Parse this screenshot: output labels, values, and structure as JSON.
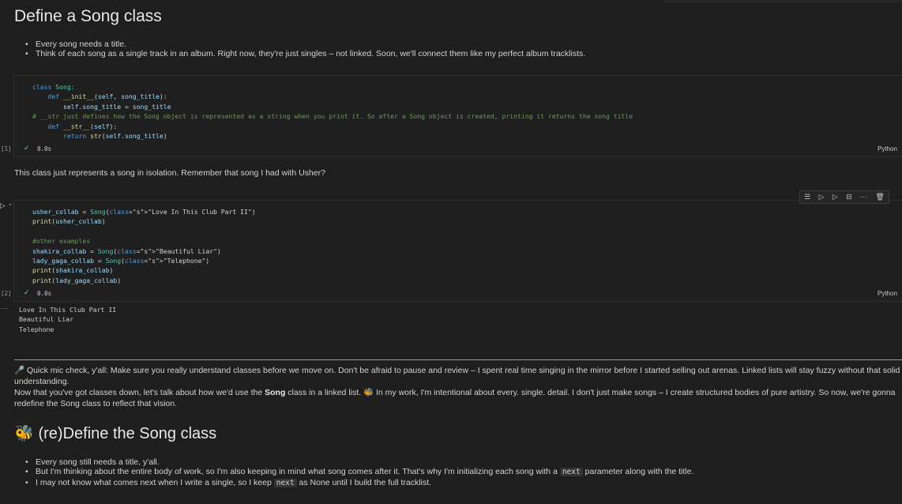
{
  "section1": {
    "title": "Define a Song class",
    "bullets": [
      "Every song needs a title.",
      "Think of each song as a single track in an album. Right now, they're just singles – not linked. Soon, we'll connect them like my perfect album tracklists."
    ]
  },
  "cell1": {
    "exec_count": "[1]",
    "status_time": "0.0s",
    "language": "Python",
    "code_lines": [
      "class Song:",
      "    def __init__(self, song_title):",
      "        self.song_title = song_title",
      "# __str just defines how the Song object is represented as a string when you print it. So after a Song object is created, printing it returns the song title",
      "    def __str__(self):",
      "        return str(self.song_title)"
    ]
  },
  "para1": "This class just represents a song in isolation. Remember that song I had with Usher?",
  "cell2": {
    "exec_count": "[2]",
    "status_time": "0.0s",
    "language": "Python",
    "code_lines": [
      "usher_collab = Song(\"Love In This Club Part II\")",
      "print(usher_collab)",
      "",
      "#other examples",
      "shakira_collab = Song(\"Beautiful Liar\")",
      "lady_gaga_collab = Song(\"Telephone\")",
      "print(shakira_collab)",
      "print(lady_gaga_collab)"
    ],
    "output_lines": [
      "Love In This Club Part II",
      "Beautiful Liar",
      "Telephone"
    ],
    "toolbar_icons": [
      "run-by-line-icon",
      "execute-above-icon",
      "execute-below-icon",
      "split-cell-icon",
      "more-icon",
      "delete-icon"
    ]
  },
  "para2": {
    "line1_icon": "🎤",
    "line1": "Quick mic check, y'all: Make sure you really understand classes before we move on. Don't be afraid to pause and review – I spent real time singing in the mirror before I started selling out arenas. Linked lists will stay fuzzy without that solid understanding.",
    "line2_prefix": "Now that you've got classes down, let's talk about how we'd use the ",
    "line2_bold": "Song",
    "line2_middle": " class in a linked list. ",
    "line2_icon": "🐝",
    "line2_suffix": " In my work, I'm intentional about every. single. detail. I don't just make songs – I create structured bodies of pure artistry. So now, we're gonna redefine the Song class to reflect that vision."
  },
  "section2": {
    "icon": "🐝",
    "title": "(re)Define the Song class",
    "bullet1": "Every song still needs a title, y'all.",
    "bullet2_prefix": "But I'm thinking about the entire body of work, so I'm also keeping in mind what song comes after it. That's why I'm initializing each song with a ",
    "bullet2_code": "next",
    "bullet2_suffix": " parameter along with the title.",
    "bullet3_prefix": "I may not know what comes next when I write a single, so I keep ",
    "bullet3_code": "next",
    "bullet3_suffix": " as None until I build the full tracklist."
  },
  "colors": {
    "background": "#1e1e1e",
    "keyword": "#569cd6",
    "function": "#dcdcaa",
    "comment": "#6a9955",
    "string": "#ce9178",
    "check": "#89d185"
  }
}
